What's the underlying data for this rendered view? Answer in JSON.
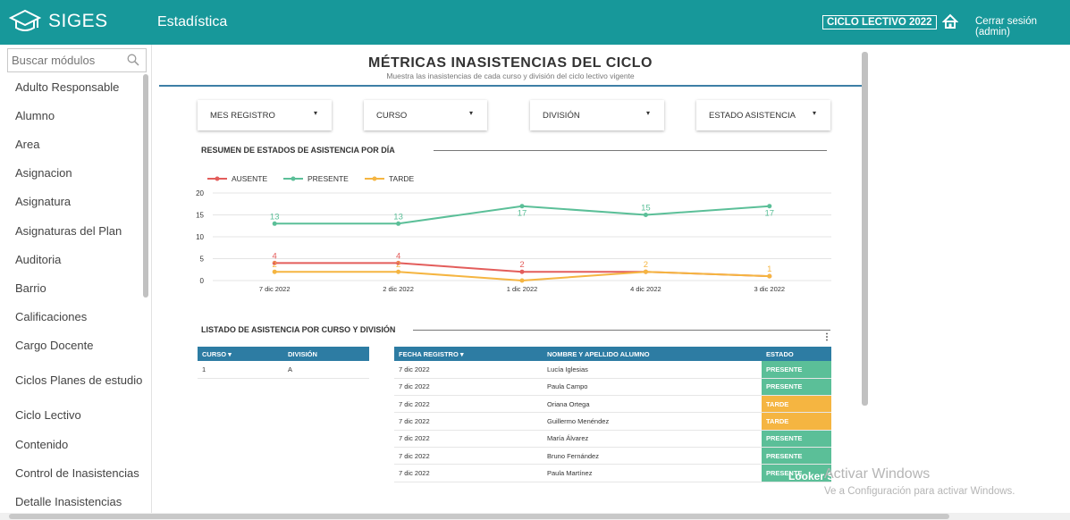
{
  "topbar": {
    "brand": "SIGES",
    "page_title": "Estadística",
    "cycle_badge": "CICLO LECTIVO 2022",
    "logout": "Cerrar sesión (admin)",
    "bg_color": "#17989a"
  },
  "sidebar": {
    "search_placeholder": "Buscar módulos",
    "items": [
      "Adulto Responsable",
      "Alumno",
      "Area",
      "Asignacion",
      "Asignatura",
      "Asignaturas del Plan",
      "Auditoria",
      "Barrio",
      "Calificaciones",
      "Cargo Docente",
      "Ciclos Planes de estudio",
      "Ciclo Lectivo",
      "Contenido",
      "Control de Inasistencias",
      "Detalle Inasistencias"
    ]
  },
  "report": {
    "title": "MÉTRICAS INASISTENCIAS DEL CICLO",
    "subtitle": "Muestra las inasistencias de cada curso y división del ciclo lectivo vigente",
    "filters": [
      "MES REGISTRO",
      "CURSO",
      "DIVISIÓN",
      "ESTADO ASISTENCIA"
    ],
    "chart_section_title": "RESUMEN DE ESTADOS DE ASISTENCIA POR DÍA",
    "table_section_title": "LISTADO  DE ASISTENCIA POR CURSO Y DIVISIÓN",
    "table1": {
      "headers": [
        "CURSO ▾",
        "DIVISIÓN"
      ],
      "rows": [
        [
          "1",
          "A"
        ]
      ]
    },
    "table2": {
      "headers": [
        "FECHA REGISTRO ▾",
        "NOMBRE Y APELLIDO ALUMNO",
        "ESTADO"
      ],
      "rows": [
        [
          "7 dic 2022",
          "Lucía Iglesias",
          "PRESENTE"
        ],
        [
          "7 dic 2022",
          "Paula Campo",
          "PRESENTE"
        ],
        [
          "7 dic 2022",
          "Oriana Ortega",
          "TARDE"
        ],
        [
          "7 dic 2022",
          "Guillermo Menéndez",
          "TARDE"
        ],
        [
          "7 dic 2022",
          "María Álvarez",
          "PRESENTE"
        ],
        [
          "7 dic 2022",
          "Bruno Fernández",
          "PRESENTE"
        ],
        [
          "7 dic 2022",
          "Paula Martínez",
          "PRESENTE"
        ]
      ]
    },
    "looker_label": "Looker Studio"
  },
  "watermark": {
    "line1": "Activar Windows",
    "line2": "Ve a Configuración para activar Windows."
  },
  "colors": {
    "ausente": "#e35d5b",
    "presente": "#5bbf98",
    "tarde": "#f5b541",
    "table_header": "#2d7ca3"
  },
  "chart_data": {
    "type": "line",
    "categories": [
      "7 dic 2022",
      "2 dic 2022",
      "1 dic 2022",
      "4 dic 2022",
      "3 dic 2022"
    ],
    "ylim": [
      0,
      20
    ],
    "yticks": [
      0,
      5,
      10,
      15,
      20
    ],
    "grid": true,
    "legend": "top-left",
    "series": [
      {
        "name": "AUSENTE",
        "values": [
          4,
          4,
          2,
          2,
          1
        ],
        "labels": [
          "4",
          "4",
          "2",
          "",
          ""
        ],
        "color": "#e35d5b"
      },
      {
        "name": "PRESENTE",
        "values": [
          13,
          13,
          17,
          15,
          17
        ],
        "labels": [
          "13",
          "13",
          "17",
          "15",
          "17"
        ],
        "color": "#5bbf98"
      },
      {
        "name": "TARDE",
        "values": [
          2,
          2,
          0,
          2,
          1
        ],
        "labels": [
          "2",
          "2",
          "",
          "2",
          "1"
        ],
        "color": "#f5b541"
      }
    ]
  }
}
